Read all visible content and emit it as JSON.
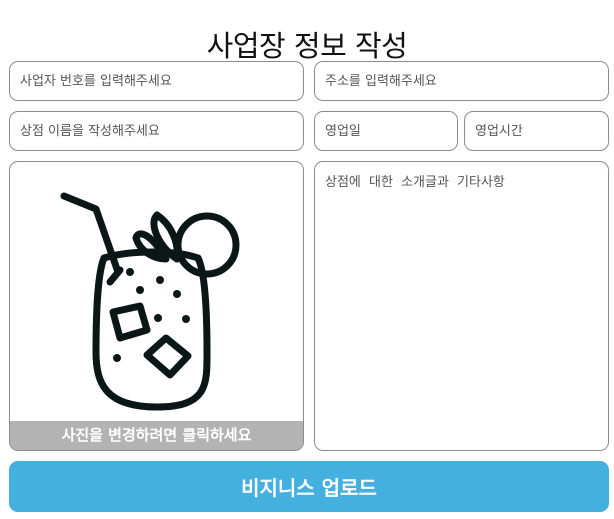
{
  "page": {
    "title": "사업장 정보 작성"
  },
  "form": {
    "business_number": {
      "placeholder": "사업자 번호를 입력해주세요",
      "value": ""
    },
    "address": {
      "placeholder": "주소를 입력해주세요",
      "value": ""
    },
    "store_name": {
      "placeholder": "상점 이름을 작성해주세요",
      "value": ""
    },
    "business_days": {
      "placeholder": "영업일",
      "value": ""
    },
    "business_hours": {
      "placeholder": "영업시간",
      "value": ""
    },
    "description": {
      "placeholder": "상점에 대한 소개글과 기타사항",
      "value": ""
    }
  },
  "photo": {
    "caption": "사진을 변경하려면 클릭하세요",
    "icon": "iced-drink-icon"
  },
  "submit": {
    "label": "비지니스 업로드"
  },
  "colors": {
    "button_bg": "#44b0df",
    "caption_bg": "#b3b3b3",
    "icon_stroke": "#0b1717"
  }
}
